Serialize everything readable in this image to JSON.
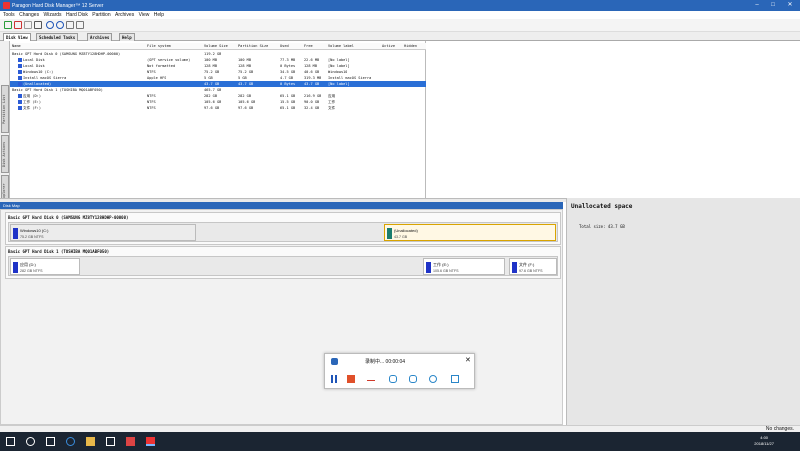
{
  "window": {
    "title": "Paragon Hard Disk Manager™ 12 Server"
  },
  "menu": [
    "Tools",
    "Changes",
    "Wizards",
    "Hard Disk",
    "Partition",
    "Archives",
    "View",
    "Help"
  ],
  "tabs": [
    {
      "label": "Disk View",
      "active": true
    },
    {
      "label": "Scheduled Tasks",
      "active": false
    },
    {
      "label": "Archives",
      "active": false
    },
    {
      "label": "Help",
      "active": false
    }
  ],
  "side_tabs": [
    "Partition List",
    "Disk Actions",
    "Volume Explorer"
  ],
  "columns": [
    "Name",
    "File system",
    "Volume Size",
    "Partition Size",
    "Used",
    "Free",
    "Volume label",
    "Active",
    "Hidden"
  ],
  "rows": [
    {
      "name": "Basic GPT Hard Disk 0 (SAMSUNG MZ8TY128HDHP-00000)",
      "fs": "",
      "vsize": "119.2 GB",
      "psize": "",
      "used": "",
      "free": "",
      "label": "",
      "indent": 0,
      "selected": false
    },
    {
      "name": "Local Disk",
      "fs": "(GPT service volume)",
      "vsize": "100 MB",
      "psize": "100 MB",
      "used": "77.3 MB",
      "free": "22.6 MB",
      "label": "[No label]",
      "indent": 1,
      "selected": false
    },
    {
      "name": "Local Disk",
      "fs": "Not formatted",
      "vsize": "128 MB",
      "psize": "128 MB",
      "used": "0 Bytes",
      "free": "128 MB",
      "label": "[No label]",
      "indent": 1,
      "selected": false
    },
    {
      "name": "Windows10 (C:)",
      "fs": "NTFS",
      "vsize": "75.2 GB",
      "psize": "75.2 GB",
      "used": "34.5 GB",
      "free": "40.6 GB",
      "label": "Windows10",
      "indent": 1,
      "selected": false
    },
    {
      "name": "Install macOS Sierra",
      "fs": "Apple HFS",
      "vsize": "5 GB",
      "psize": "5 GB",
      "used": "4.7 GB",
      "free": "319.3 MB",
      "label": "Install macOS Sierra",
      "indent": 1,
      "selected": false
    },
    {
      "name": "(Unallocated)",
      "fs": "",
      "vsize": "43.7 GB",
      "psize": "43.7 GB",
      "used": "0 Bytes",
      "free": "43.7 GB",
      "label": "[No label]",
      "indent": 1,
      "selected": true
    },
    {
      "name": "Basic GPT Hard Disk 1 (TOSHIBA MQ01ABF050)",
      "fs": "",
      "vsize": "465.7 GB",
      "psize": "",
      "used": "",
      "free": "",
      "label": "",
      "indent": 0,
      "selected": false
    },
    {
      "name": "应用 (D:)",
      "fs": "NTFS",
      "vsize": "282 GB",
      "psize": "282 GB",
      "used": "65.1 GB",
      "free": "216.9 GB",
      "label": "应用",
      "indent": 1,
      "selected": false
    },
    {
      "name": "工作 (E:)",
      "fs": "NTFS",
      "vsize": "105.6 GB",
      "psize": "105.6 GB",
      "used": "15.5 GB",
      "free": "90.0 GB",
      "label": "工作",
      "indent": 1,
      "selected": false
    },
    {
      "name": "文件 (F:)",
      "fs": "NTFS",
      "vsize": "97.6 GB",
      "psize": "97.6 GB",
      "used": "65.1 GB",
      "free": "32.4 GB",
      "label": "文件",
      "indent": 1,
      "selected": false
    }
  ],
  "disk_map": {
    "title": "Disk Map",
    "disk0": {
      "title": "Basic GPT Hard Disk 0 (SAMSUNG MZ8TY128HDHP-00000)",
      "p1_name": "Windows10 (C:)",
      "p1_size": "75.2 GB NTFS",
      "p2_name": "(Unallocated)",
      "p2_size": "43.7 GB"
    },
    "disk1": {
      "title": "Basic GPT Hard Disk 1 (TOSHIBA MQ01ABF050)",
      "p1_name": "应用 (D:)",
      "p1_size": "282 GB NTFS",
      "p2_name": "工作 (E:)",
      "p2_size": "105.6 GB NTFS",
      "p3_name": "文件 (F:)",
      "p3_size": "97.6 GB NTFS"
    }
  },
  "info_panel": {
    "title": "Unallocated space",
    "total_label": "Total size:",
    "total_value": "43.7 GB"
  },
  "recorder": {
    "title": "录制中... 00:00:04",
    "close": "✕"
  },
  "status": {
    "text": "No changes."
  },
  "clock": {
    "time": "4:00",
    "date": "2018/11/27"
  },
  "colors": {
    "titlebar": "#2a66b8",
    "selection": "#2a6fd6",
    "partition_block": "#1f33c7",
    "unallocated_block": "#1a7d6e",
    "taskbar": "#1b2532"
  }
}
